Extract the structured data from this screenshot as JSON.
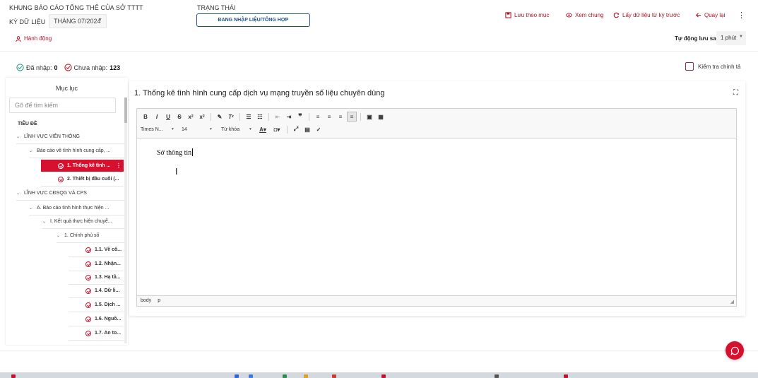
{
  "header": {
    "title": "KHUNG BÁO CÁO TỔNG THỂ CỦA SỞ TTTT",
    "period_label": "KỲ DỮ LIỆU",
    "period_value": "THÁNG 07/2024",
    "status_label": "TRẠNG THÁI",
    "status_value": "ĐANG NHẬP LIỆU/TỔNG HỢP",
    "actions": {
      "save": "Lưu theo mục",
      "preview": "Xem chung",
      "fetch_previous": "Lấy dữ liệu từ kỳ trước",
      "back": "Quay lại"
    }
  },
  "subheader": {
    "actions_link": "Hành động",
    "autosave_label": "Tự động lưu sau",
    "autosave_value": "1 phút"
  },
  "counts": {
    "entered_label": "Đã nhập:",
    "entered_value": "0",
    "not_entered_label": "Chưa nhập:",
    "not_entered_value": "123"
  },
  "spellcheck_label": "Kiểm tra chính tả",
  "sidebar": {
    "title": "Mục lục",
    "search_placeholder": "Gõ để tìm kiếm",
    "header": "TIÊU ĐỀ",
    "items": [
      {
        "label": "LĨNH VỰC VIỄN THÔNG"
      },
      {
        "label": "Báo cáo về tình hình cung cấp, ..."
      },
      {
        "label": "1. Thống kê tình ..."
      },
      {
        "label": "2. Thiết bị đầu cuối (..."
      },
      {
        "label": "LĨNH VỰC CĐSQG VÀ CPS"
      },
      {
        "label": "A. Báo cáo tình hình thực hiện ..."
      },
      {
        "label": "I. Kết quả thực hiện chuyể..."
      },
      {
        "label": "1. Chính phủ số"
      },
      {
        "label": "1.1. Về cô..."
      },
      {
        "label": "1.2. Nhận..."
      },
      {
        "label": "1.3. Hạ tầ..."
      },
      {
        "label": "1.4. Dữ li..."
      },
      {
        "label": "1.5. Dịch ..."
      },
      {
        "label": "1.6. Nguồ..."
      },
      {
        "label": "1.7. An to..."
      }
    ]
  },
  "main": {
    "title": "1. Thống kê tình hình cung cấp dịch vụ mạng truyền số liệu chuyên dùng",
    "toolbar": {
      "font_family": "Times N...",
      "font_size": "14",
      "keyword": "Từ khóa"
    },
    "content_text": "Sở thông tin",
    "statusbar": [
      "body",
      "p"
    ]
  },
  "colors": {
    "accent": "#d7102f",
    "link": "#b0102a",
    "status_blue": "#1f4f91"
  }
}
